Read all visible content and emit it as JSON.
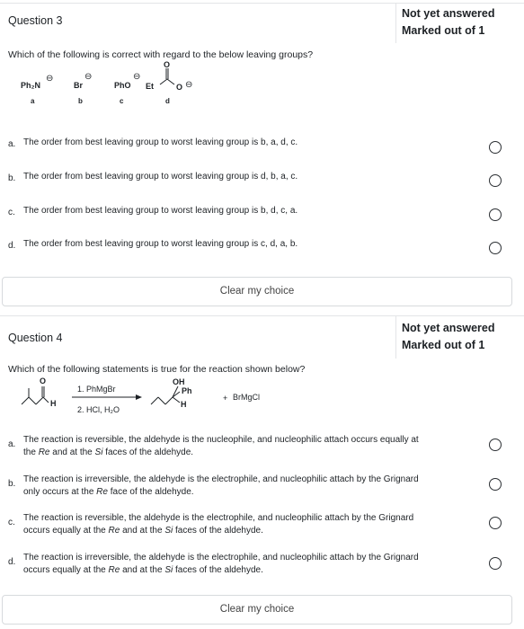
{
  "q3": {
    "title": "Question 3",
    "status": "Not yet answered",
    "marks": "Marked out of 1",
    "prompt": "Which of the following is correct with regard to the below leaving groups?",
    "groups": [
      {
        "formula": "Ph₂N",
        "charge": "⊖",
        "label": "a"
      },
      {
        "formula": "Br",
        "charge": "⊖",
        "label": "b"
      },
      {
        "formula": "PhO",
        "charge": "⊖",
        "label": "c"
      },
      {
        "formula": "Et",
        "charge": "⊖",
        "label": "d",
        "carbonyl_o": "O",
        "anion_o": "O"
      }
    ],
    "options": [
      {
        "letter": "a.",
        "text": "The order from best leaving group to worst leaving group is b, a, d, c."
      },
      {
        "letter": "b.",
        "text": "The order from best leaving group to worst leaving group is d, b, a, c."
      },
      {
        "letter": "c.",
        "text": "The order from best leaving group to worst leaving group is b, d, c, a."
      },
      {
        "letter": "d.",
        "text": "The order from best leaving group to worst leaving group is c, d, a, b."
      }
    ],
    "clear_label": "Clear my choice"
  },
  "q4": {
    "title": "Question 4",
    "status": "Not yet answered",
    "marks": "Marked out of 1",
    "prompt": "Which of the following statements is true for the reaction shown below?",
    "reaction": {
      "reactant_o": "O",
      "reactant_h": "H",
      "step1": "1. PhMgBr",
      "step2": "2. HCl, H₂O",
      "product_oh": "OH",
      "product_ph": "Ph",
      "product_h": "H",
      "plus": "+",
      "byproduct": "BrMgCl"
    },
    "options": [
      {
        "letter": "a.",
        "line1": "The reaction is reversible, the aldehyde is the nucleophile, and nucleophilic attach occurs equally at",
        "line2_pre": "the ",
        "re": "Re",
        "mid": " and at the ",
        "si": "Si",
        "post": " faces of the aldehyde."
      },
      {
        "letter": "b.",
        "line1": "The reaction is irreversible, the aldehyde is the electrophile, and nucleophilic attach by the Grignard",
        "line2_pre": "only occurs at the ",
        "re": "Re",
        "mid": " face of the aldehyde.",
        "si": "",
        "post": ""
      },
      {
        "letter": "c.",
        "line1": "The reaction is reversible, the aldehyde is the electrophile, and nucleophilic attach by the Grignard",
        "line2_pre": "occurs equally at the ",
        "re": "Re",
        "mid": " and at the ",
        "si": "Si",
        "post": " faces of the aldehyde."
      },
      {
        "letter": "d.",
        "line1": "The reaction is irreversible, the aldehyde is the electrophile, and nucleophilic attach by the Grignard",
        "line2_pre": "occurs equally at the ",
        "re": "Re",
        "mid": " and at the ",
        "si": "Si",
        "post": " faces of the aldehyde."
      }
    ],
    "clear_label": "Clear my choice"
  }
}
